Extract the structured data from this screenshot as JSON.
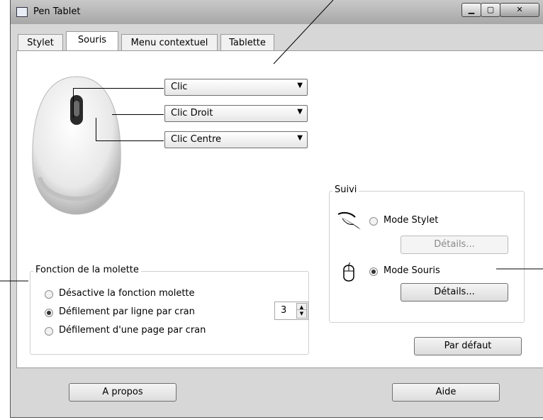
{
  "window": {
    "title": "Pen Tablet"
  },
  "tabs": [
    {
      "label": "Stylet"
    },
    {
      "label": "Souris"
    },
    {
      "label": "Menu contextuel"
    },
    {
      "label": "Tablette"
    }
  ],
  "buttons_map": {
    "left": "Clic",
    "right": "Clic Droit",
    "center": "Clic Centre"
  },
  "wheel": {
    "legend": "Fonction de la molette",
    "options": [
      {
        "label": "Désactive la fonction molette",
        "selected": false
      },
      {
        "label": "Défilement par ligne par cran",
        "selected": true
      },
      {
        "label": "Défilement d'une page par cran",
        "selected": false
      }
    ],
    "lines_value": "3"
  },
  "tracking": {
    "legend": "Suivi",
    "pen_mode": "Mode Stylet",
    "pen_details": "Détails...",
    "mouse_mode": "Mode Souris",
    "mouse_details": "Détails...",
    "selected": "mouse"
  },
  "footer": {
    "default_button": "Par défaut",
    "about_button": "A propos",
    "help_button": "Aide"
  }
}
